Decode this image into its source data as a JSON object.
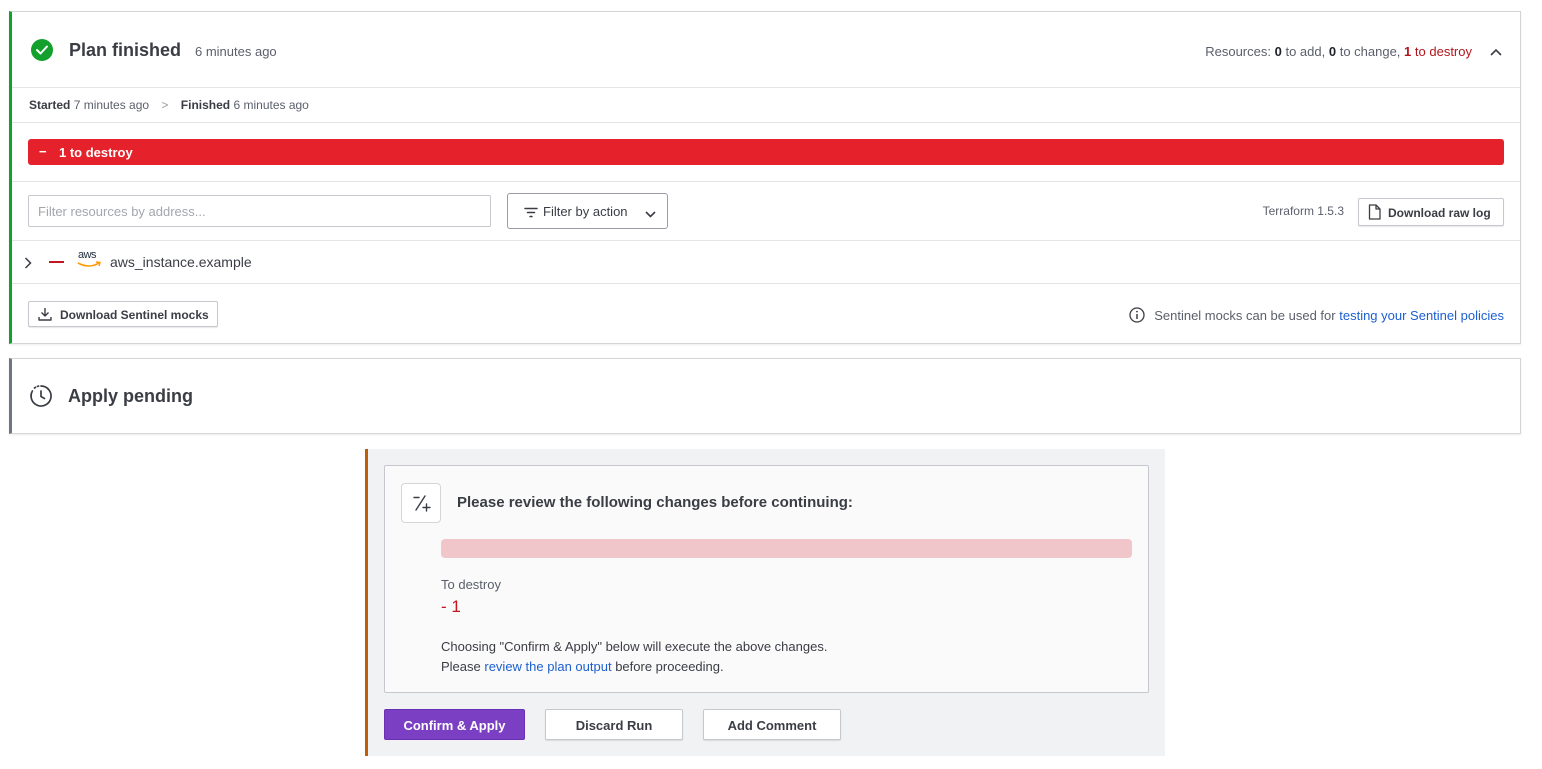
{
  "plan": {
    "title": "Plan finished",
    "time_ago": "6 minutes ago",
    "resources": {
      "prefix": "Resources:",
      "add_count": "0",
      "add_label": "to add,",
      "change_count": "0",
      "change_label": "to change,",
      "destroy_count": "1",
      "destroy_label": "to destroy"
    },
    "meta": {
      "started_label": "Started",
      "started_value": "7 minutes ago",
      "separator": ">",
      "finished_label": "Finished",
      "finished_value": "6 minutes ago"
    },
    "destroy_bar": {
      "symbol": "−",
      "label": "1 to destroy"
    },
    "filter": {
      "placeholder": "Filter resources by address...",
      "action_button": "Filter by action"
    },
    "terraform_version": "Terraform 1.5.3",
    "download_raw_log": "Download raw log",
    "resource_item": {
      "provider_text": "aws",
      "address": "aws_instance.example"
    },
    "download_sentinel_mocks": "Download Sentinel mocks",
    "sentinel_note": {
      "text": "Sentinel mocks can be used for",
      "link": "testing your Sentinel policies"
    }
  },
  "apply": {
    "title": "Apply pending"
  },
  "review": {
    "title": "Please review the following changes before continuing:",
    "to_destroy_label": "To destroy",
    "to_destroy_value": "- 1",
    "explain_line1": "Choosing \"Confirm & Apply\" below will execute the above changes.",
    "explain_line2_prefix": "Please",
    "explain_line2_link": "review the plan output",
    "explain_line2_suffix": "before proceeding.",
    "buttons": {
      "confirm": "Confirm & Apply",
      "discard": "Discard Run",
      "comment": "Add Comment"
    }
  },
  "colors": {
    "success": "#14a02c",
    "destroy": "#e5222b",
    "destroy_text": "#c4161f",
    "primary": "#7b3fc4",
    "link": "#1d5fd0",
    "review_accent": "#c25d07"
  }
}
